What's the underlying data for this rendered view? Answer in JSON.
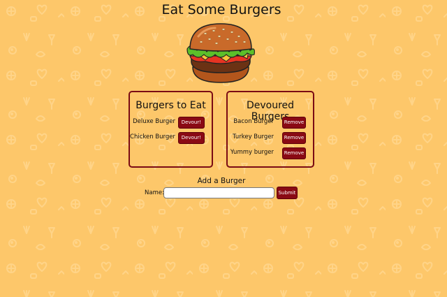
{
  "page": {
    "title": "Eat Some Burgers"
  },
  "colors": {
    "background": "#fdc76a",
    "accent": "#8a0a14",
    "panel_border": "#7a0b14"
  },
  "to_eat": {
    "heading": "Burgers to Eat",
    "items": [
      {
        "name": "Deluxe Burger",
        "button_label": "Devour!"
      },
      {
        "name": "Chicken Burger",
        "button_label": "Devour!"
      }
    ]
  },
  "devoured": {
    "heading": "Devoured Burgers",
    "items": [
      {
        "name": "Bacon Burger",
        "button_label": "Remove"
      },
      {
        "name": "Turkey Burger",
        "button_label": "Remove"
      },
      {
        "name": "Yummy burger",
        "button_label": "Remove"
      }
    ]
  },
  "add_form": {
    "heading": "Add a Burger",
    "name_label": "Name:",
    "name_value": "",
    "submit_label": "Submit"
  },
  "icons": {
    "logo": "burger-logo",
    "background": "food-doodle-pattern"
  }
}
